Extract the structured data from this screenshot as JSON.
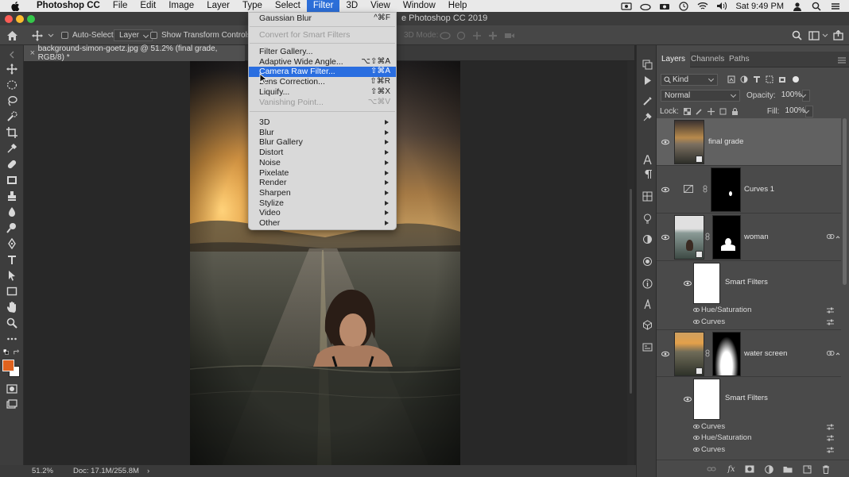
{
  "menubar": {
    "items": [
      "Photoshop CC",
      "File",
      "Edit",
      "Image",
      "Layer",
      "Type",
      "Select",
      "Filter",
      "3D",
      "View",
      "Window",
      "Help"
    ],
    "active_index": 7,
    "clock": "Sat 9:49 PM"
  },
  "window": {
    "title_fragment": "e Photoshop CC 2019"
  },
  "options": {
    "auto_select_label": "Auto-Select:",
    "auto_select_value": "Layer",
    "transform_label": "Show Transform Controls",
    "mode_3d": "3D Mode:"
  },
  "document": {
    "tab_title": "background-simon-goetz.jpg @ 51.2% (final grade, RGB/8) *"
  },
  "status": {
    "zoom": "51.2%",
    "doc": "Doc: 17.1M/255.8M"
  },
  "filter_menu": {
    "items": [
      {
        "label": "Gaussian Blur",
        "shortcut": "^⌘F"
      },
      {
        "label": "Convert for Smart Filters",
        "disabled": true
      },
      {
        "label": "Filter Gallery..."
      },
      {
        "label": "Adaptive Wide Angle...",
        "shortcut": "⌥⇧⌘A"
      },
      {
        "label": "Camera Raw Filter...",
        "shortcut": "⇧⌘A",
        "highlighted": true
      },
      {
        "label": "Lens Correction...",
        "shortcut": "⇧⌘R"
      },
      {
        "label": "Liquify...",
        "shortcut": "⇧⌘X"
      },
      {
        "label": "Vanishing Point...",
        "shortcut": "⌥⌘V",
        "disabled": true
      },
      {
        "label": "3D",
        "submenu": true
      },
      {
        "label": "Blur",
        "submenu": true
      },
      {
        "label": "Blur Gallery",
        "submenu": true
      },
      {
        "label": "Distort",
        "submenu": true
      },
      {
        "label": "Noise",
        "submenu": true
      },
      {
        "label": "Pixelate",
        "submenu": true
      },
      {
        "label": "Render",
        "submenu": true
      },
      {
        "label": "Sharpen",
        "submenu": true
      },
      {
        "label": "Stylize",
        "submenu": true
      },
      {
        "label": "Video",
        "submenu": true
      },
      {
        "label": "Other",
        "submenu": true
      }
    ]
  },
  "layers_panel": {
    "tabs": [
      "Layers",
      "Channels",
      "Paths"
    ],
    "filter_kind": "Kind",
    "blend_mode": "Normal",
    "opacity_label": "Opacity:",
    "opacity_value": "100%",
    "lock_label": "Lock:",
    "fill_label": "Fill:",
    "fill_value": "100%",
    "layers": {
      "final_grade": "final grade",
      "curves1": "Curves 1",
      "woman": "woman",
      "woman_smart_filters": "Smart Filters",
      "woman_filters": [
        "Hue/Saturation",
        "Curves"
      ],
      "water_screen": "water screen",
      "water_smart_filters": "Smart Filters",
      "water_filters": [
        "Curves",
        "Hue/Saturation",
        "Curves"
      ]
    }
  },
  "colors": {
    "menu_highlight": "#2a6ee0",
    "foreground_swatch": "#e0621e",
    "background_swatch": "#ffffff"
  }
}
